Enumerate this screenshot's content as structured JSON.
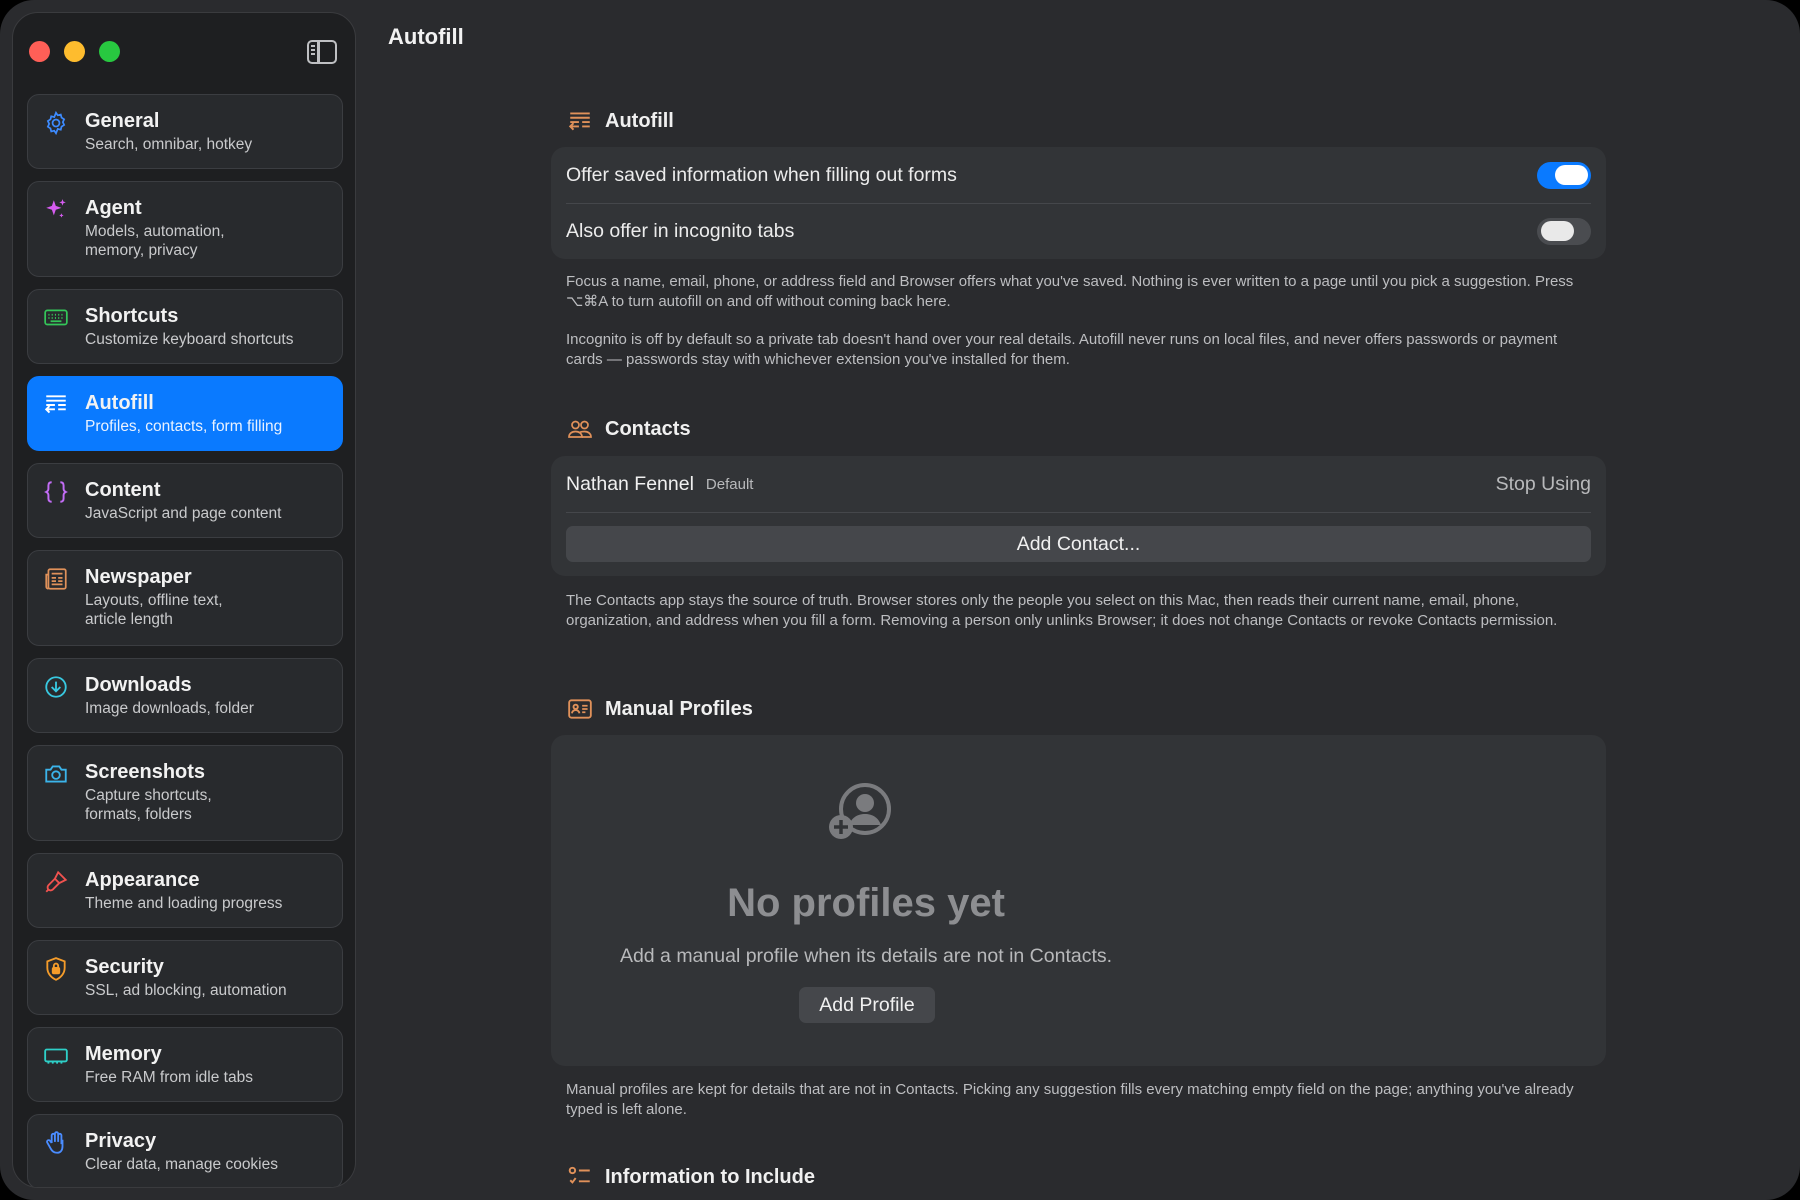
{
  "window": {
    "title": "Autofill"
  },
  "sidebar": {
    "items": [
      {
        "label": "General",
        "sub": "Search, omnibar, hotkey",
        "icon": "gear-icon"
      },
      {
        "label": "Agent",
        "sub": "Models, automation,\nmemory, privacy",
        "icon": "sparkles-icon"
      },
      {
        "label": "Shortcuts",
        "sub": "Customize keyboard shortcuts",
        "icon": "keyboard-icon"
      },
      {
        "label": "Autofill",
        "sub": "Profiles, contacts, form filling",
        "icon": "autofill-icon",
        "active": true
      },
      {
        "label": "Content",
        "sub": "JavaScript and page content",
        "icon": "braces-icon"
      },
      {
        "label": "Newspaper",
        "sub": "Layouts, offline text,\narticle length",
        "icon": "newspaper-icon"
      },
      {
        "label": "Downloads",
        "sub": "Image downloads, folder",
        "icon": "download-icon"
      },
      {
        "label": "Screenshots",
        "sub": "Capture shortcuts,\nformats, folders",
        "icon": "camera-icon"
      },
      {
        "label": "Appearance",
        "sub": "Theme and loading progress",
        "icon": "paintbrush-icon"
      },
      {
        "label": "Security",
        "sub": "SSL, ad blocking, automation",
        "icon": "lock-shield-icon"
      },
      {
        "label": "Memory",
        "sub": "Free RAM from idle tabs",
        "icon": "memory-chip-icon"
      },
      {
        "label": "Privacy",
        "sub": "Clear data, manage cookies",
        "icon": "hand-icon"
      }
    ]
  },
  "autofill": {
    "heading": "Autofill",
    "offer_label": "Offer saved information when filling out forms",
    "offer_enabled": true,
    "incognito_label": "Also offer in incognito tabs",
    "incognito_enabled": false,
    "help_1": "Focus a name, email, phone, or address field and Browser offers what you've saved. Nothing is ever written to a page until you pick a suggestion. Press ⌥⌘A to turn autofill on and off without coming back here.",
    "help_2": "Incognito is off by default so a private tab doesn't hand over your real details. Autofill never runs on local files, and never offers passwords or payment cards — passwords stay with whichever extension you've installed for them."
  },
  "contacts": {
    "heading": "Contacts",
    "contact_name": "Nathan Fennel",
    "contact_badge": "Default",
    "stop_using_label": "Stop Using",
    "add_contact_label": "Add Contact...",
    "help": "The Contacts app stays the source of truth. Browser stores only the people you select on this Mac, then reads their current name, email, phone, organization, and address when you fill a form. Removing a person only unlinks Browser; it does not change Contacts or revoke Contacts permission."
  },
  "manual_profiles": {
    "heading": "Manual Profiles",
    "empty_title": "No profiles yet",
    "empty_subtitle": "Add a manual profile when its details are not in Contacts.",
    "add_profile_label": "Add Profile",
    "help": "Manual profiles are kept for details that are not in Contacts. Picking any suggestion fills every matching empty field on the page; anything you've already typed is left alone."
  },
  "information_to_include": {
    "heading": "Information to Include"
  },
  "colors": {
    "accent": "#0a7aff",
    "background": "#2a2b2e",
    "sidebar": "#1e1f21",
    "card": "#323437"
  }
}
